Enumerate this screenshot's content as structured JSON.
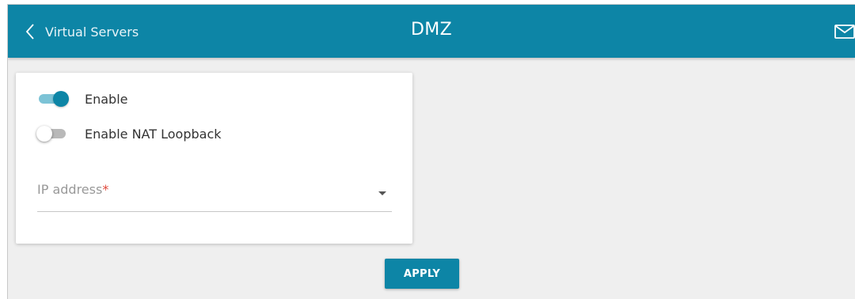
{
  "header": {
    "back_label": "Virtual Servers",
    "title": "DMZ",
    "back_icon": "chevron-left-icon",
    "mail_icon": "mail-icon",
    "bg_color": "#0d85a6"
  },
  "settings": {
    "enable": {
      "label": "Enable",
      "checked": true
    },
    "nat_loopback": {
      "label": "Enable NAT Loopback",
      "checked": false
    },
    "ip_address": {
      "label": "IP address",
      "required_mark": "*",
      "value": ""
    }
  },
  "actions": {
    "apply_label": "APPLY"
  },
  "colors": {
    "accent": "#0d85a6",
    "accent_light": "#7cc3d6",
    "required": "#e0473a"
  }
}
